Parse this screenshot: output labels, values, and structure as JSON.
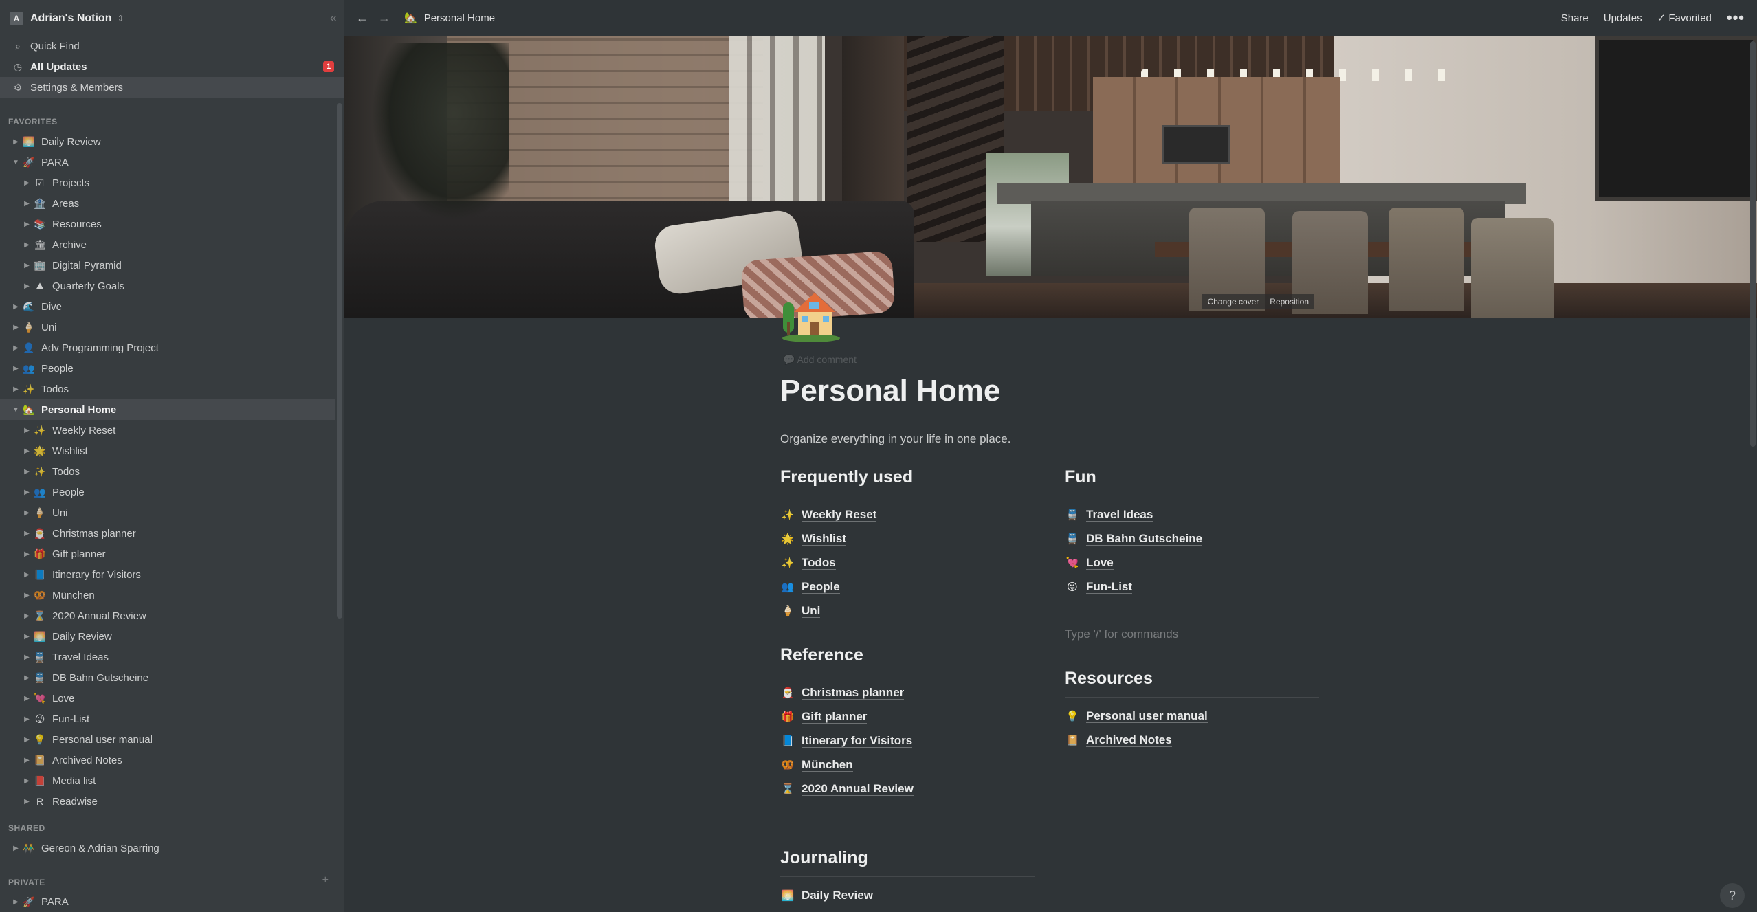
{
  "workspace": {
    "avatar": "A",
    "name": "Adrian's Notion"
  },
  "sidebar_actions": [
    {
      "label": "Quick Find",
      "icon": "search-icon"
    },
    {
      "label": "All Updates",
      "icon": "clock-icon",
      "badge": "1"
    },
    {
      "label": "Settings & Members",
      "icon": "gear-icon"
    }
  ],
  "sections": {
    "favorites": "FAVORITES",
    "shared": "SHARED",
    "private": "PRIVATE"
  },
  "favorites": [
    {
      "label": "Daily Review",
      "emoji": "🌅"
    },
    {
      "label": "PARA",
      "emoji": "🚀"
    },
    {
      "label": "Projects",
      "emoji": "☑"
    },
    {
      "label": "Areas",
      "emoji": "🏦"
    },
    {
      "label": "Resources",
      "emoji": "📚"
    },
    {
      "label": "Archive",
      "emoji": "🏛"
    },
    {
      "label": "Digital Pyramid",
      "emoji": "🏢"
    },
    {
      "label": "Quarterly Goals",
      "emoji": "⛰"
    },
    {
      "label": "Dive",
      "emoji": "🌊"
    },
    {
      "label": "Uni",
      "emoji": "🍦"
    },
    {
      "label": "Adv Programming Project",
      "emoji": "👤"
    },
    {
      "label": "People",
      "emoji": "👥"
    },
    {
      "label": "Todos",
      "emoji": "✨"
    },
    {
      "label": "Personal Home",
      "emoji": "🏡"
    },
    {
      "label": "Weekly Reset",
      "emoji": "✨"
    },
    {
      "label": "Wishlist",
      "emoji": "🌟"
    },
    {
      "label": "Todos",
      "emoji": "✨"
    },
    {
      "label": "People",
      "emoji": "👥"
    },
    {
      "label": "Uni",
      "emoji": "🍦"
    },
    {
      "label": "Christmas planner",
      "emoji": "🎅"
    },
    {
      "label": "Gift planner",
      "emoji": "🎁"
    },
    {
      "label": "Itinerary for Visitors",
      "emoji": "📘"
    },
    {
      "label": "München",
      "emoji": "🥨"
    },
    {
      "label": "2020 Annual Review",
      "emoji": "⌛"
    },
    {
      "label": "Daily Review",
      "emoji": "🌅"
    },
    {
      "label": "Travel Ideas",
      "emoji": "🚆"
    },
    {
      "label": "DB Bahn Gutscheine",
      "emoji": "🚆"
    },
    {
      "label": "Love",
      "emoji": "💘"
    },
    {
      "label": "Fun-List",
      "emoji": "😜"
    },
    {
      "label": "Personal user manual",
      "emoji": "💡"
    },
    {
      "label": "Archived Notes",
      "emoji": "📔"
    },
    {
      "label": "Media list",
      "emoji": "📕"
    },
    {
      "label": "Readwise",
      "emoji": "R"
    }
  ],
  "shared": [
    {
      "label": "Gereon & Adrian Sparring",
      "emoji": "👬"
    }
  ],
  "private": [
    {
      "label": "PARA",
      "emoji": "🚀"
    }
  ],
  "topbar": {
    "breadcrumb_emoji": "🏡",
    "breadcrumb": "Personal Home",
    "share": "Share",
    "updates": "Updates",
    "favorited": "✓ Favorited",
    "more": "•••"
  },
  "cover": {
    "change_cover": "Change cover",
    "reposition": "Reposition"
  },
  "page": {
    "add_comment": "💬 Add comment",
    "title": "Personal Home",
    "description": "Organize everything in your life in one place."
  },
  "frequently_used": {
    "heading": "Frequently used",
    "links": [
      {
        "emoji": "✨",
        "label": "Weekly Reset"
      },
      {
        "emoji": "🌟",
        "label": "Wishlist"
      },
      {
        "emoji": "✨",
        "label": "Todos"
      },
      {
        "emoji": "👥",
        "label": "People"
      },
      {
        "emoji": "🍦",
        "label": "Uni"
      }
    ]
  },
  "reference": {
    "heading": "Reference",
    "links": [
      {
        "emoji": "🎅",
        "label": "Christmas planner"
      },
      {
        "emoji": "🎁",
        "label": "Gift planner"
      },
      {
        "emoji": "📘",
        "label": "Itinerary for Visitors"
      },
      {
        "emoji": "🥨",
        "label": "München"
      },
      {
        "emoji": "⌛",
        "label": "2020 Annual Review"
      }
    ]
  },
  "journaling": {
    "heading": "Journaling",
    "links": [
      {
        "emoji": "🌅",
        "label": "Daily Review"
      }
    ]
  },
  "fun": {
    "heading": "Fun",
    "links": [
      {
        "emoji": "🚆",
        "label": "Travel Ideas"
      },
      {
        "emoji": "🚆",
        "label": "DB Bahn Gutscheine"
      },
      {
        "emoji": "💘",
        "label": "Love"
      },
      {
        "emoji": "😜",
        "label": "Fun-List"
      }
    ]
  },
  "type_hint": "Type '/' for commands",
  "resources": {
    "heading": "Resources",
    "links": [
      {
        "emoji": "💡",
        "label": "Personal user manual"
      },
      {
        "emoji": "📔",
        "label": "Archived Notes"
      }
    ]
  },
  "help": "?"
}
